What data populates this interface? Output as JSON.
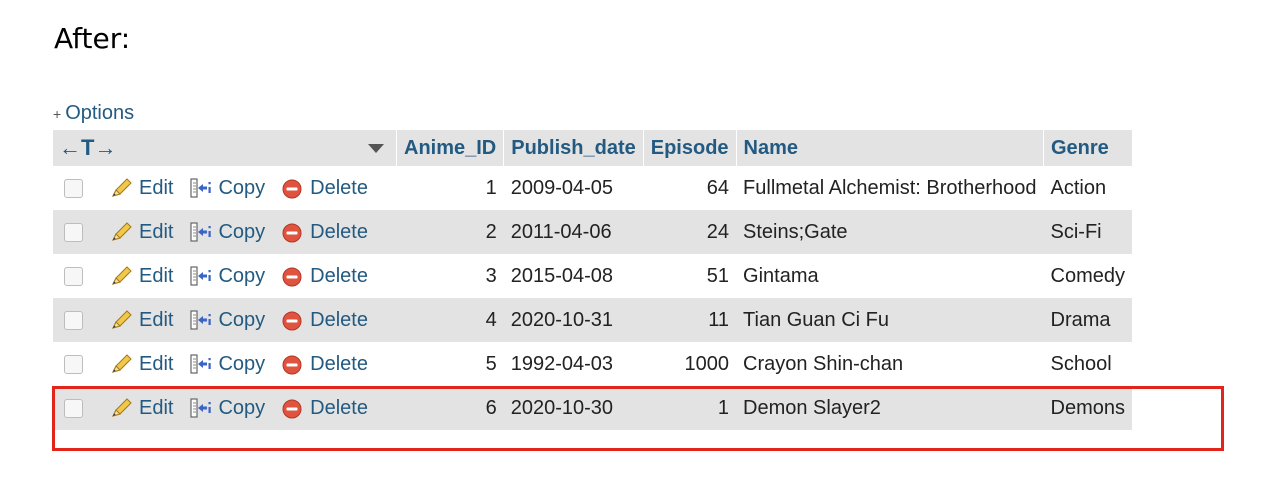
{
  "heading": "After:",
  "options_label": "Options",
  "options_icon": "plus-minus-icon",
  "columns": {
    "arrows": "←T→",
    "anime_id": "Anime_ID",
    "publish_date": "Publish_date",
    "episode": "Episode",
    "name": "Name",
    "genre": "Genre"
  },
  "actions": {
    "edit": "Edit",
    "copy": "Copy",
    "delete": "Delete"
  },
  "rows": [
    {
      "anime_id": "1",
      "publish_date": "2009-04-05",
      "episode": "64",
      "name": "Fullmetal Alchemist: Brotherhood",
      "genre": "Action"
    },
    {
      "anime_id": "2",
      "publish_date": "2011-04-06",
      "episode": "24",
      "name": "Steins;Gate",
      "genre": "Sci-Fi"
    },
    {
      "anime_id": "3",
      "publish_date": "2015-04-08",
      "episode": "51",
      "name": "Gintama",
      "genre": "Comedy"
    },
    {
      "anime_id": "4",
      "publish_date": "2020-10-31",
      "episode": "11",
      "name": "Tian Guan Ci Fu",
      "genre": "Drama"
    },
    {
      "anime_id": "5",
      "publish_date": "1992-04-03",
      "episode": "1000",
      "name": "Crayon Shin-chan",
      "genre": "School"
    },
    {
      "anime_id": "6",
      "publish_date": "2020-10-30",
      "episode": "1",
      "name": "Demon Slayer2",
      "genre": "Demons"
    }
  ],
  "colors": {
    "link": "#235a81",
    "stripe": "#e3e3e3",
    "highlight_border": "#e3241b"
  }
}
